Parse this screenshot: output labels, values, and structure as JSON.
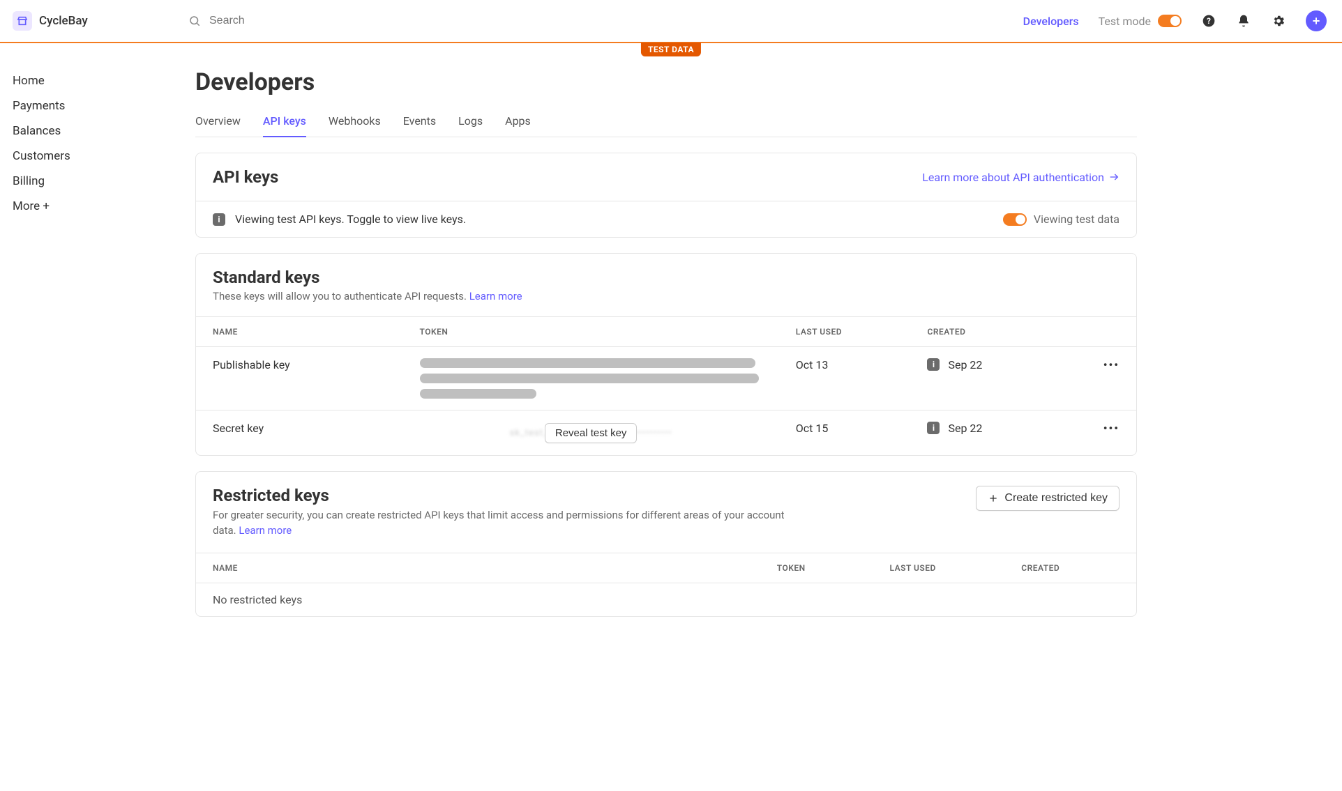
{
  "brand": {
    "name": "CycleBay"
  },
  "search": {
    "placeholder": "Search"
  },
  "top": {
    "developers": "Developers",
    "test_mode": "Test mode",
    "badge": "TEST DATA"
  },
  "sidebar": {
    "items": [
      {
        "label": "Home"
      },
      {
        "label": "Payments"
      },
      {
        "label": "Balances"
      },
      {
        "label": "Customers"
      },
      {
        "label": "Billing"
      },
      {
        "label": "More +"
      }
    ]
  },
  "page": {
    "title": "Developers"
  },
  "tabs": [
    {
      "label": "Overview",
      "active": false
    },
    {
      "label": "API keys",
      "active": true
    },
    {
      "label": "Webhooks",
      "active": false
    },
    {
      "label": "Events",
      "active": false
    },
    {
      "label": "Logs",
      "active": false
    },
    {
      "label": "Apps",
      "active": false
    }
  ],
  "apikeys": {
    "heading": "API keys",
    "learn_link": "Learn more about API authentication",
    "notice": "Viewing test API keys. Toggle to view live keys.",
    "toggle_label": "Viewing test data"
  },
  "standard": {
    "heading": "Standard keys",
    "sub_prefix": "These keys will allow you to authenticate API requests. ",
    "learn_more": "Learn more",
    "columns": {
      "name": "NAME",
      "token": "TOKEN",
      "last_used": "LAST USED",
      "created": "CREATED"
    },
    "rows": [
      {
        "name": "Publishable key",
        "last_used": "Oct 13",
        "created": "Sep 22"
      },
      {
        "name": "Secret key",
        "last_used": "Oct 15",
        "created": "Sep 22"
      }
    ],
    "reveal_label": "Reveal test key"
  },
  "restricted": {
    "heading": "Restricted keys",
    "sub_prefix": "For greater security, you can create restricted API keys that limit access and permissions for different areas of your account data. ",
    "learn_more": "Learn more",
    "create_label": "Create restricted key",
    "columns": {
      "name": "NAME",
      "token": "TOKEN",
      "last_used": "LAST USED",
      "created": "CREATED"
    },
    "empty": "No restricted keys"
  }
}
